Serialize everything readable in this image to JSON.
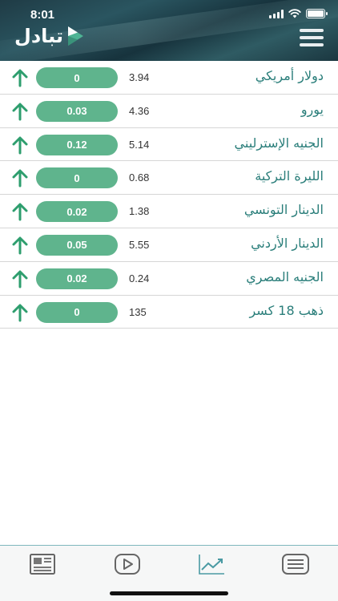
{
  "status_bar": {
    "time": "8:01"
  },
  "header": {
    "logo_text": "تبادل"
  },
  "rates": [
    {
      "name": "دولار أمريكي",
      "value": "3.94",
      "change": "0"
    },
    {
      "name": "يورو",
      "value": "4.36",
      "change": "0.03"
    },
    {
      "name": "الجنيه الإسترليني",
      "value": "5.14",
      "change": "0.12"
    },
    {
      "name": "الليرة التركية",
      "value": "0.68",
      "change": "0"
    },
    {
      "name": "الدينار التونسي",
      "value": "1.38",
      "change": "0.02"
    },
    {
      "name": "الدينار الأردني",
      "value": "5.55",
      "change": "0.05"
    },
    {
      "name": "الجنيه المصري",
      "value": "0.24",
      "change": "0.02"
    },
    {
      "name": "ذهب 18 كسر",
      "value": "135",
      "change": "0"
    }
  ],
  "tabbar": {
    "tabs": [
      {
        "icon": "newspaper-icon"
      },
      {
        "icon": "play-icon"
      },
      {
        "icon": "chart-icon",
        "active": true
      },
      {
        "icon": "list-icon"
      }
    ]
  },
  "colors": {
    "header": "#1f3b45",
    "pill": "#5fb48d",
    "arrow": "#2e9e6e",
    "name_text": "#2a7e7a",
    "tab_icon": "#555555",
    "tab_active": "#4a9aa3"
  }
}
